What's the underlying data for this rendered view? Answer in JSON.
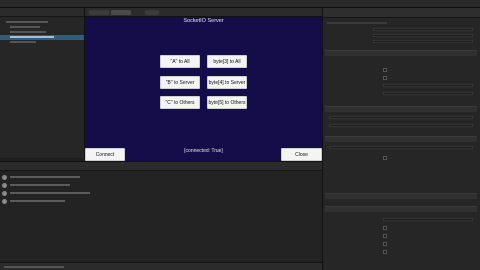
{
  "game": {
    "title": "SocketIO Server",
    "buttons": {
      "a_to_all": "\"A\" to All",
      "byte3_to_all": "byte[3] to All",
      "b_to_server": "\"B\" to Server",
      "byte4_to_server": "byte[4] to Server",
      "c_to_others": "\"C\" to Others",
      "byte5_to_others": "byte[5] to Others",
      "connect": "Connect",
      "close": "Close"
    },
    "status": "[connected: True]"
  },
  "colors": {
    "game_background": "#150c4a",
    "button_background": "#f4f4f4",
    "selection": "#2c5d87",
    "editor_background": "#1e1e1e"
  }
}
